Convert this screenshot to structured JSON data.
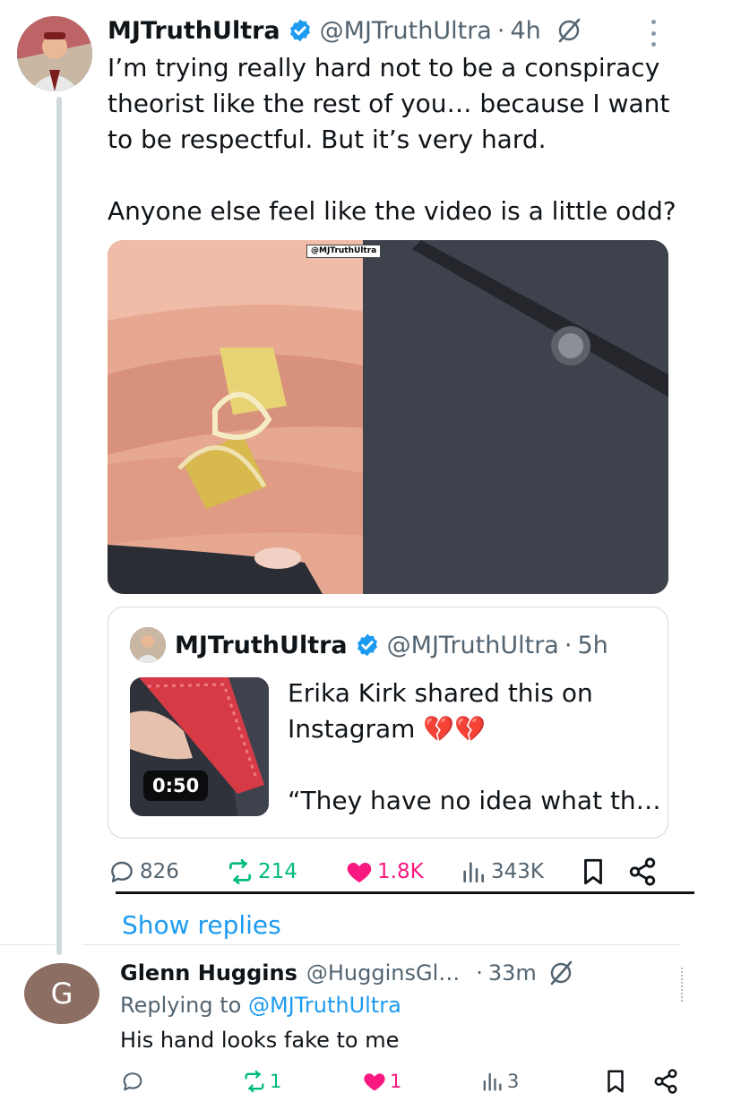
{
  "main_post": {
    "display_name": "MJTruthUltra",
    "handle": "@MJTruthUltra",
    "separator": "·",
    "time": "4h",
    "text": "I’m trying really hard not to be a conspiracy theorist like the rest of you… because I want to be respectful. But it’s very hard.\n\nAnyone else feel like the video is a little odd?",
    "media_watermark": "@MJTruthUltra",
    "quoted_post": {
      "display_name": "MJTruthUltra",
      "handle": "@MJTruthUltra",
      "separator": "·",
      "time": "5h",
      "text": "Erika Kirk shared this on Instagram 💔💔",
      "text_line2": "“They have no idea what th…",
      "video_duration": "0:50"
    },
    "actions": {
      "replies": "826",
      "reposts": "214",
      "likes": "1.8K",
      "views": "343K"
    }
  },
  "show_replies_label": "Show replies",
  "reply": {
    "avatar_letter": "G",
    "display_name": "Glenn Huggins",
    "handle": "@HugginsGl…",
    "separator": "·",
    "time": "33m",
    "replying_prefix": "Replying to",
    "replying_to": "@MJTruthUltra",
    "text": "His hand looks fake to me",
    "actions": {
      "replies": "",
      "reposts": "1",
      "likes": "1",
      "views": "3"
    }
  },
  "colors": {
    "accent_blue": "#1d9bf0",
    "repost_green": "#00ba7c",
    "like_pink": "#f91880",
    "muted_gray": "#536471"
  },
  "icons": [
    "verified-badge-icon",
    "grok-icon",
    "more-icon",
    "reply-icon",
    "repost-icon",
    "like-icon",
    "views-icon",
    "bookmark-icon",
    "share-icon"
  ]
}
